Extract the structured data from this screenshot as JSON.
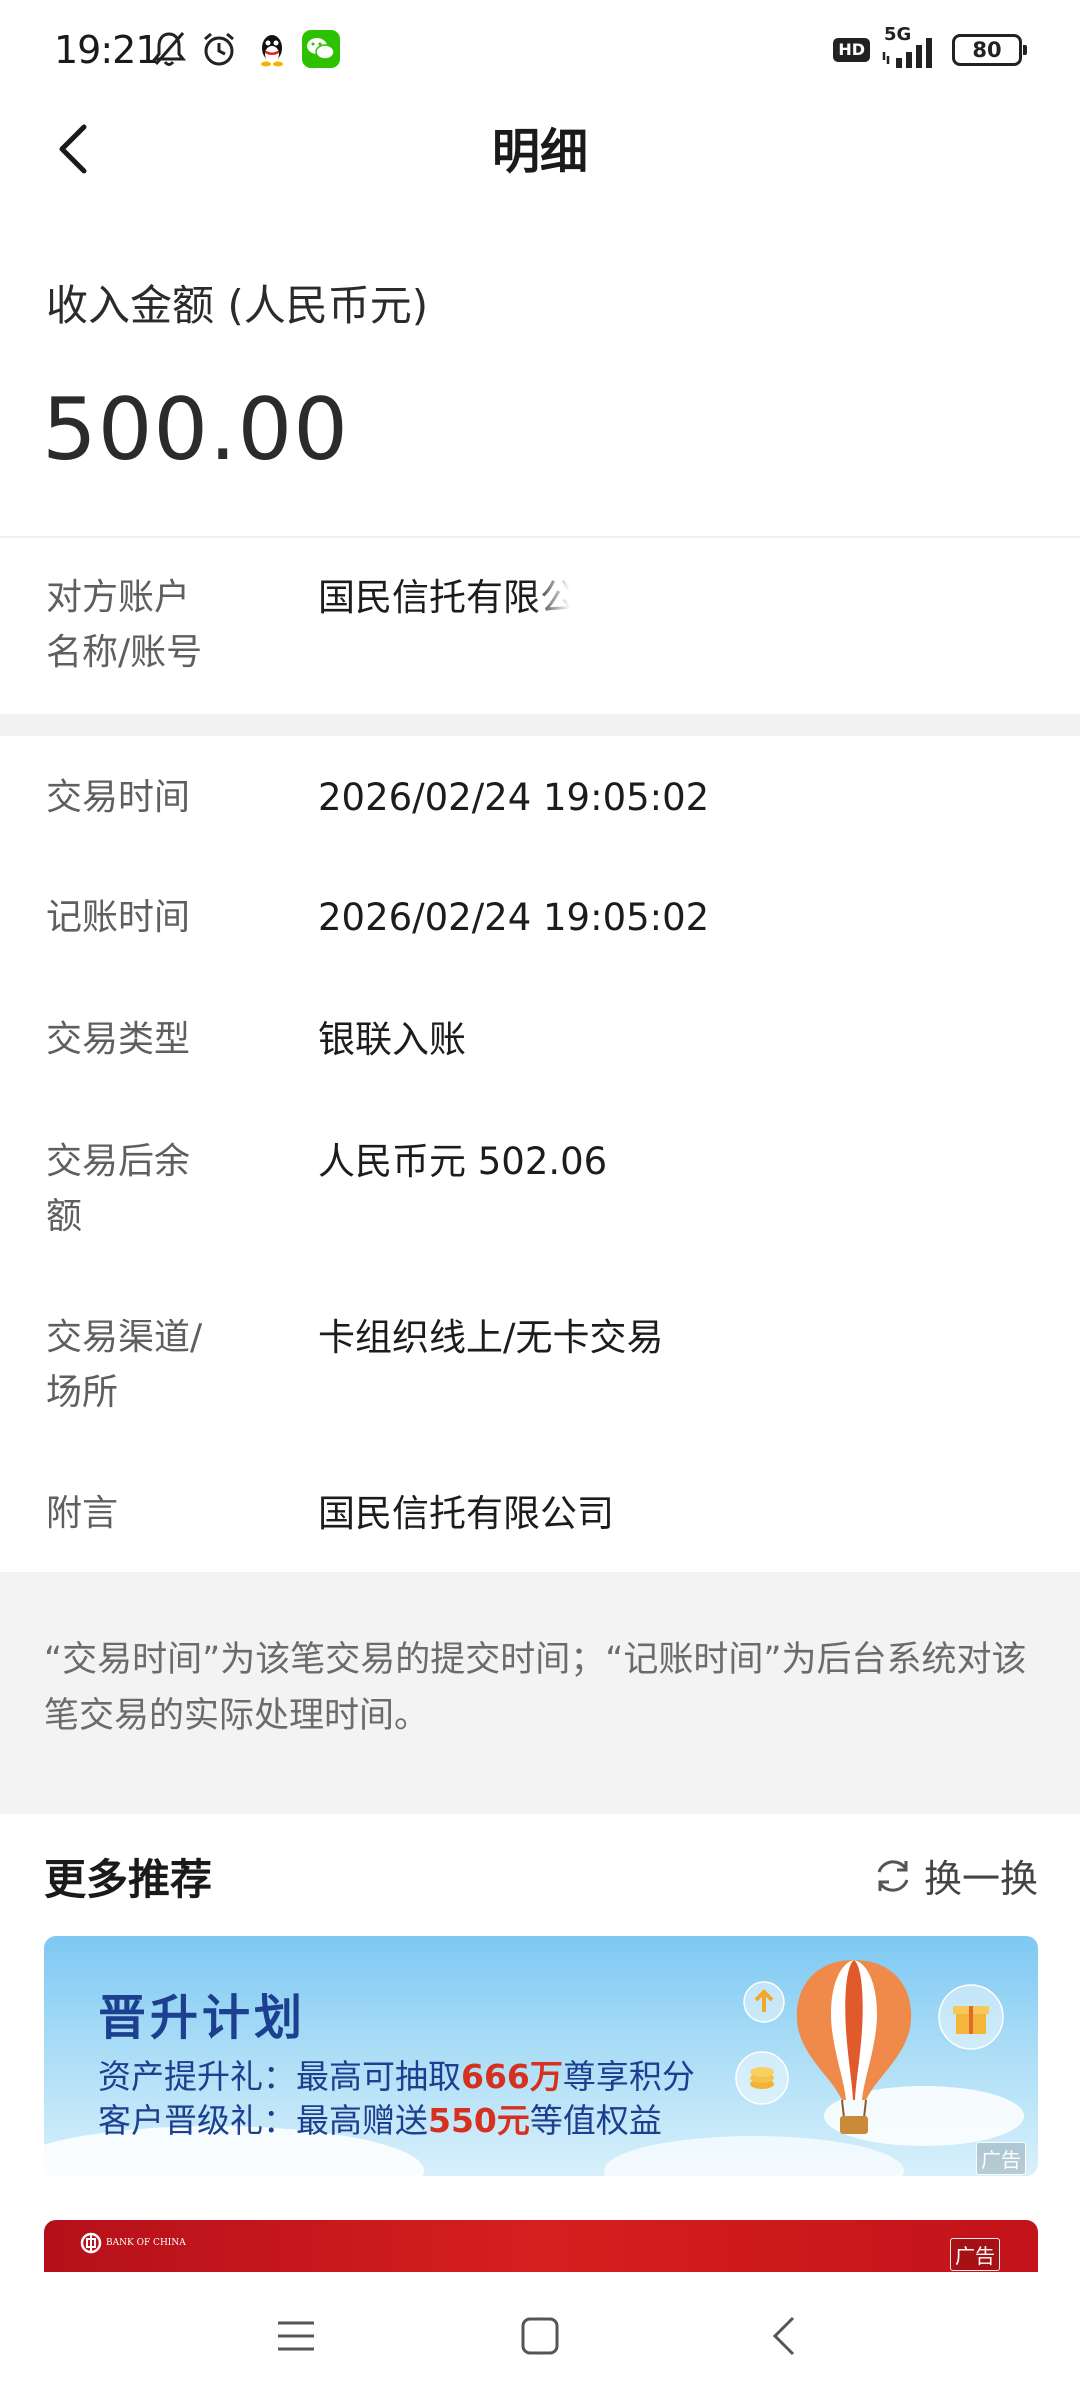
{
  "status_bar": {
    "time": "19:21",
    "network": "5G",
    "hd": "HD",
    "battery": "80",
    "icons": [
      "bell-off-icon",
      "alarm-icon",
      "qq-icon",
      "wechat-icon",
      "signal-icon"
    ]
  },
  "header": {
    "title": "明细",
    "back_icon": "chevron-left-icon"
  },
  "amount": {
    "label": "收入金额 (人民币元)",
    "value": "500.00"
  },
  "counterparty": {
    "label": "对方账户名称/账号",
    "value": "国民信托有限公"
  },
  "details": [
    {
      "label": "交易时间",
      "value": "2026/02/24 19:05:02"
    },
    {
      "label": "记账时间",
      "value": "2026/02/24 19:05:02"
    },
    {
      "label": "交易类型",
      "value": "银联入账"
    },
    {
      "label": "交易后余额",
      "value": "人民币元 502.06"
    },
    {
      "label": "交易渠道/场所",
      "value": "卡组织线上/无卡交易"
    },
    {
      "label": "附言",
      "value": "国民信托有限公司"
    }
  ],
  "note": "“交易时间”为该笔交易的提交时间；“记账时间”为后台系统对该笔交易的实际处理时间。",
  "recommend": {
    "title": "更多推荐",
    "refresh_label": "换一换",
    "refresh_icon": "refresh-icon",
    "banner1": {
      "title": "晋升计划",
      "line1_prefix": "资产提升礼：最高可抽取",
      "line1_highlight": "666万",
      "line1_suffix": "尊享积分",
      "line2_prefix": "客户晋级礼：最高赠送",
      "line2_highlight": "550元",
      "line2_suffix": "等值权益",
      "ad_tag": "广告"
    },
    "banner2": {
      "brand": "BANK OF CHINA",
      "ad_tag": "广告"
    }
  },
  "nav_bar": {
    "icons": [
      "menu-icon",
      "home-square-icon",
      "back-triangle-icon"
    ]
  }
}
